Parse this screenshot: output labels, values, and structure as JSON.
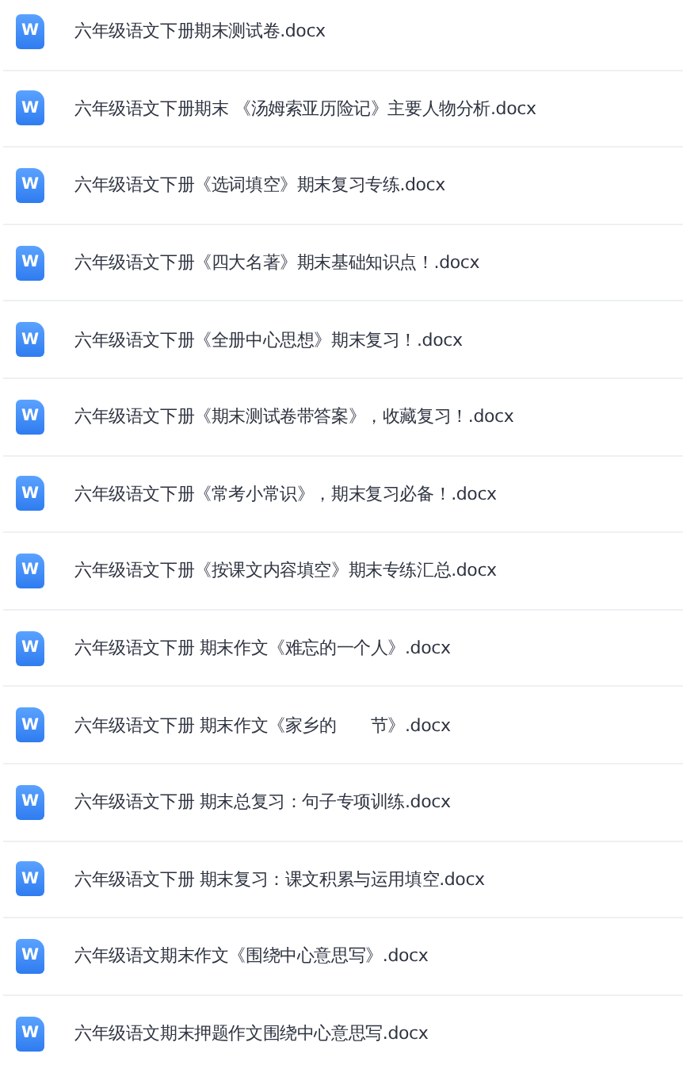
{
  "files": [
    {
      "icon_text": "W",
      "name": "六年级语文下册期末测试卷.docx"
    },
    {
      "icon_text": "W",
      "name": "六年级语文下册期末 《汤姆索亚历险记》主要人物分析.docx"
    },
    {
      "icon_text": "W",
      "name": "六年级语文下册《选词填空》期末复习专练.docx"
    },
    {
      "icon_text": "W",
      "name": "六年级语文下册《四大名著》期末基础知识点！.docx"
    },
    {
      "icon_text": "W",
      "name": "六年级语文下册《全册中心思想》期末复习！.docx"
    },
    {
      "icon_text": "W",
      "name": "六年级语文下册《期末测试卷带答案》，收藏复习！.docx"
    },
    {
      "icon_text": "W",
      "name": "六年级语文下册《常考小常识》，期末复习必备！.docx"
    },
    {
      "icon_text": "W",
      "name": "六年级语文下册《按课文内容填空》期末专练汇总.docx"
    },
    {
      "icon_text": "W",
      "name": "六年级语文下册 期末作文《难忘的一个人》.docx"
    },
    {
      "icon_text": "W",
      "name": "六年级语文下册 期末作文《家乡的　　节》.docx"
    },
    {
      "icon_text": "W",
      "name": "六年级语文下册 期末总复习：句子专项训练.docx"
    },
    {
      "icon_text": "W",
      "name": "六年级语文下册 期末复习：课文积累与运用填空.docx"
    },
    {
      "icon_text": "W",
      "name": "六年级语文期末作文《围绕中心意思写》.docx"
    },
    {
      "icon_text": "W",
      "name": "六年级语文期末押题作文围绕中心意思写.docx"
    }
  ]
}
